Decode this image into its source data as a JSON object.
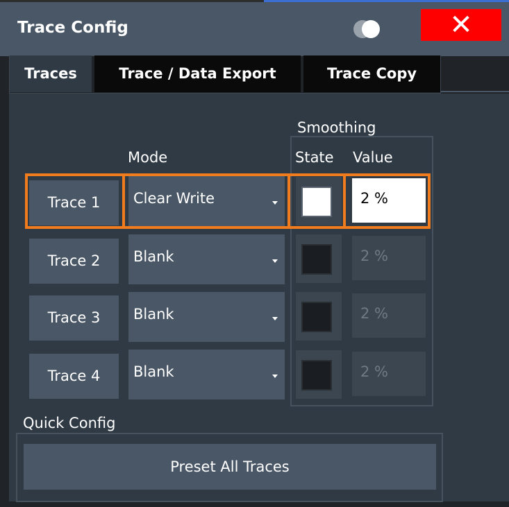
{
  "window": {
    "title": "Trace Config",
    "close_label": "✕"
  },
  "tabs": [
    {
      "label": "Traces",
      "active": true
    },
    {
      "label": "Trace / Data Export",
      "active": false
    },
    {
      "label": "Trace Copy",
      "active": false
    }
  ],
  "traces_panel": {
    "smoothing_label": "Smoothing",
    "mode_header": "Mode",
    "state_header": "State",
    "value_header": "Value",
    "rows": [
      {
        "trace": "Trace 1",
        "mode": "Clear Write",
        "smoothing_on": true,
        "value": "2 %",
        "selected": true
      },
      {
        "trace": "Trace 2",
        "mode": "Blank",
        "smoothing_on": false,
        "value": "2 %",
        "selected": false
      },
      {
        "trace": "Trace 3",
        "mode": "Blank",
        "smoothing_on": false,
        "value": "2 %",
        "selected": false
      },
      {
        "trace": "Trace 4",
        "mode": "Blank",
        "smoothing_on": false,
        "value": "2 %",
        "selected": false
      }
    ]
  },
  "quick_config": {
    "label": "Quick Config",
    "preset_label": "Preset All Traces"
  },
  "colors": {
    "title_bar": "#4a5766",
    "close": "#ff0000",
    "selection": "#f07c1e",
    "panel": "#2f3a45",
    "button": "#4a5766"
  }
}
